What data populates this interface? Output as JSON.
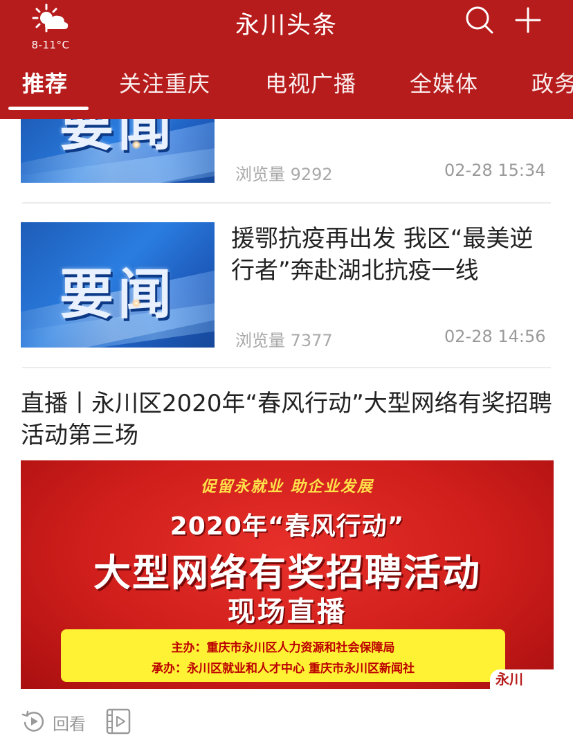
{
  "header": {
    "weather": {
      "icon": "partly-sunny-icon",
      "temperature": "8-11°C"
    },
    "title": "永川头条",
    "icons": [
      "search-icon",
      "plus-icon"
    ],
    "background_color": "#b71c1c"
  },
  "tabs": [
    {
      "label": "推荐",
      "active": true
    },
    {
      "label": "关注重庆",
      "active": false
    },
    {
      "label": "电视广播",
      "active": false
    },
    {
      "label": "全媒体",
      "active": false
    },
    {
      "label": "政务",
      "active": false
    }
  ],
  "feed": {
    "item1": {
      "thumbnail_text": "要闻",
      "views": "浏览量 9292",
      "time": "02-28 15:34"
    },
    "item2": {
      "thumbnail_text": "要闻",
      "title": "援鄂抗疫再出发 我区“最美逆行者”奔赴湖北抗疫一线",
      "views": "浏览量 7377",
      "time": "02-28 14:56"
    },
    "live": {
      "title": "直播丨永川区2020年“春风行动”大型网络有奖招聘活动第三场",
      "banner": {
        "slogan": "促留永就业  助企业发展",
        "line1": "2020年“春风行动”",
        "line2": "大型网络有奖招聘活动",
        "line3": "现场直播",
        "organizer": "主办：重庆市永川区人力资源和社会保障局",
        "co_organizers": "承办：永川区就业和人才中心      重庆市永川区新闻社",
        "watermark": "永川"
      },
      "actions": {
        "replay_icon": "replay-icon",
        "replay_label": "回看",
        "video_icon": "video-list-icon"
      }
    }
  }
}
